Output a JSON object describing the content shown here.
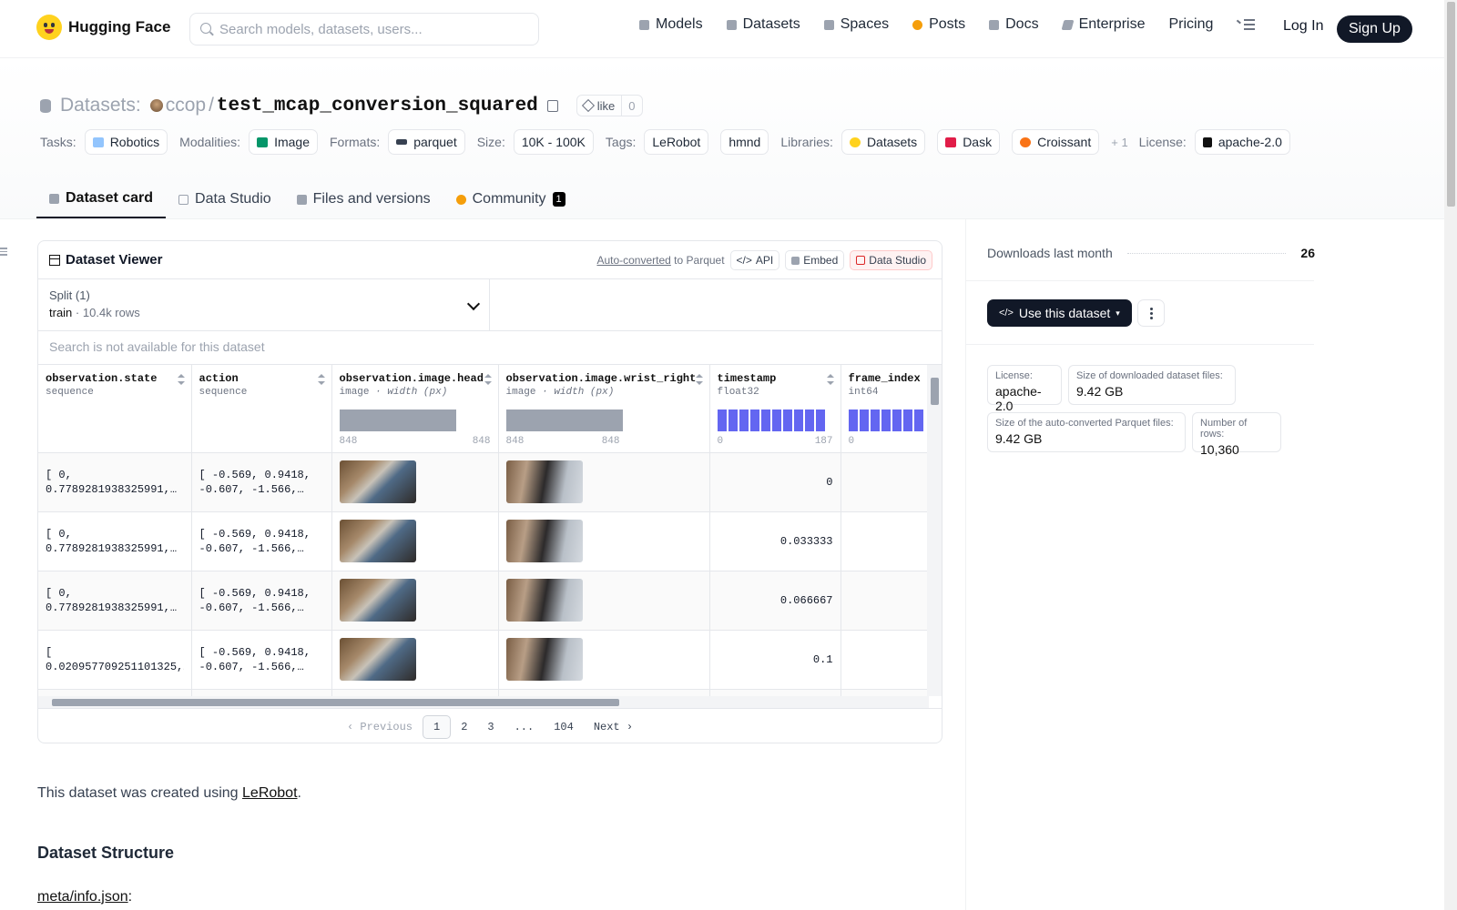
{
  "nav": {
    "brand": "Hugging Face",
    "search_placeholder": "Search models, datasets, users...",
    "links": [
      "Models",
      "Datasets",
      "Spaces",
      "Posts",
      "Docs",
      "Enterprise",
      "Pricing"
    ],
    "login": "Log In",
    "signup": "Sign Up"
  },
  "header": {
    "section": "Datasets:",
    "owner": "ccop",
    "sep": "/",
    "name": "test_mcap_conversion_squared",
    "like_label": "like",
    "like_count": "0",
    "tags": {
      "tasks_label": "Tasks:",
      "tasks": "Robotics",
      "modalities_label": "Modalities:",
      "modalities": "Image",
      "formats_label": "Formats:",
      "formats": "parquet",
      "size_label": "Size:",
      "size": "10K - 100K",
      "tags_label": "Tags:",
      "tag1": "LeRobot",
      "tag2": "hmnd",
      "libraries_label": "Libraries:",
      "lib1": "Datasets",
      "lib2": "Dask",
      "lib3": "Croissant",
      "more": "+ 1",
      "license_label": "License:",
      "license": "apache-2.0"
    }
  },
  "tabs": [
    {
      "label": "Dataset card"
    },
    {
      "label": "Data Studio"
    },
    {
      "label": "Files and versions"
    },
    {
      "label": "Community",
      "badge": "1"
    }
  ],
  "viewer": {
    "title": "Dataset Viewer",
    "auto_converted": "Auto-converted",
    "to_parquet": "to Parquet",
    "api": "API",
    "embed": "Embed",
    "data_studio": "Data Studio",
    "split_label": "Split (1)",
    "split_name": "train",
    "split_rows": "10.4k rows",
    "search_disabled": "Search is not available for this dataset",
    "columns": [
      {
        "name": "observation.state",
        "type": "sequence"
      },
      {
        "name": "action",
        "type": "sequence"
      },
      {
        "name": "observation.image.head",
        "type": "image",
        "sub": "· width (px)",
        "min": "848",
        "max": "848"
      },
      {
        "name": "observation.image.wrist_right",
        "type": "image",
        "sub": "· width (px)",
        "min": "848",
        "max": "848"
      },
      {
        "name": "timestamp",
        "type": "float32",
        "min": "0",
        "max": "187"
      },
      {
        "name": "frame_index",
        "type": "int64",
        "min": "0"
      }
    ],
    "rows": [
      {
        "state": "[ 0, 0.7789281938325991,…",
        "action": "[ -0.569, 0.9418, -0.607, -1.566,…",
        "timestamp": "0"
      },
      {
        "state": "[ 0, 0.7789281938325991,…",
        "action": "[ -0.569, 0.9418, -0.607, -1.566,…",
        "timestamp": "0.033333"
      },
      {
        "state": "[ 0, 0.7789281938325991,…",
        "action": "[ -0.569, 0.9418, -0.607, -1.566,…",
        "timestamp": "0.066667"
      },
      {
        "state": "[ 0.020957709251101325,…",
        "action": "[ -0.569, 0.9418, -0.607, -1.566,…",
        "timestamp": "0.1"
      }
    ],
    "pager": {
      "prev": "Previous",
      "p1": "1",
      "p2": "2",
      "p3": "3",
      "ellipsis": "...",
      "last": "104",
      "next": "Next"
    }
  },
  "body": {
    "intro_prefix": "This dataset was created using ",
    "intro_link": "LeRobot",
    "intro_suffix": ".",
    "structure_heading": "Dataset Structure",
    "meta_link": "meta/info.json",
    "meta_suffix": ":"
  },
  "sidebar": {
    "downloads_label": "Downloads last month",
    "downloads_value": "26",
    "use_button": "Use this dataset",
    "license_k": "License:",
    "license_v": "apache-2.0",
    "dl_size_k": "Size of downloaded dataset files:",
    "dl_size_v": "9.42 GB",
    "pq_size_k": "Size of the auto-converted Parquet files:",
    "pq_size_v": "9.42 GB",
    "rows_k": "Number of rows:",
    "rows_v": "10,360"
  }
}
